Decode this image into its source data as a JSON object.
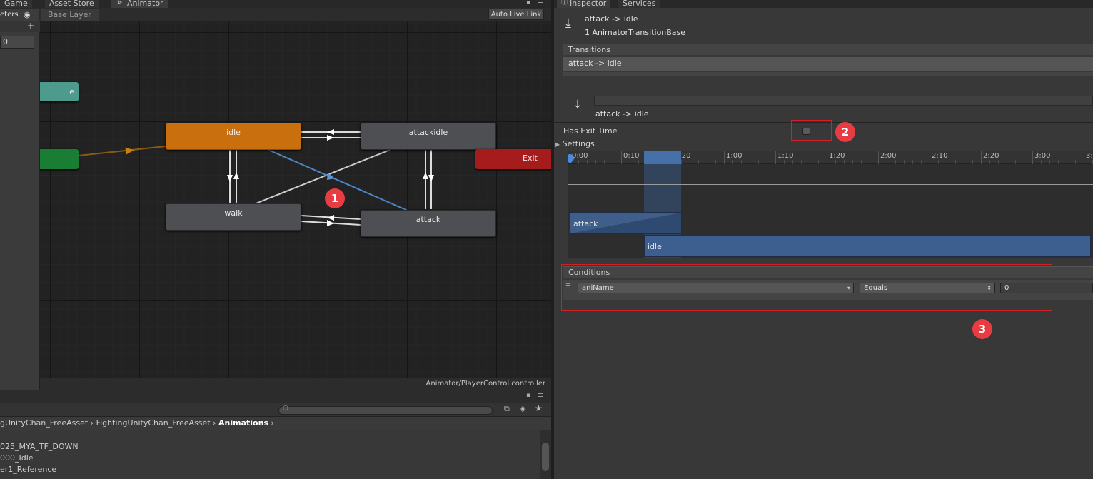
{
  "tabs": {
    "game": "Game",
    "asset_store": "Asset Store",
    "animator": "Animator",
    "inspector": "Inspector",
    "services": "Services"
  },
  "animator": {
    "params_label": "eters",
    "layer": "Base Layer",
    "auto_live_link": "Auto Live Link",
    "param_value": "0",
    "footer_path": "Animator/PlayerControl.controller",
    "states": {
      "idle": "idle",
      "attackidle": "attackidle",
      "walk": "walk",
      "attack": "attack",
      "exit": "Exit",
      "any": "e"
    },
    "badge_1": "1"
  },
  "project": {
    "breadcrumb": [
      "gUnityChan_FreeAsset",
      "FightingUnityChan_FreeAsset",
      "Animations"
    ],
    "files": [
      "025_MYA_TF_DOWN",
      "000_Idle",
      "er1_Reference"
    ]
  },
  "inspector": {
    "title": "attack -> idle",
    "subtitle": "1 AnimatorTransitionBase",
    "transitions_header": "Transitions",
    "transitions_item": "attack -> idle",
    "transition_name": "attack -> idle",
    "has_exit_time_label": "Has Exit Time",
    "has_exit_time": false,
    "settings_label": "Settings",
    "badge_2": "2",
    "badge_3": "3",
    "timeline": {
      "ticks": [
        "0:00",
        "0:10",
        "0:20",
        "1:00",
        "1:10",
        "1:20",
        "2:00",
        "2:10",
        "2:20",
        "3:00",
        "3:"
      ],
      "clip_from": "attack",
      "clip_to": "idle"
    },
    "conditions_header": "Conditions",
    "condition": {
      "parameter": "aniName",
      "mode": "Equals",
      "value": "0"
    }
  },
  "colors": {
    "idle_state": "#c96f0e",
    "exit_state": "#a61b1b",
    "entry_state": "#1a7d34",
    "any_state": "#4d9b8c",
    "selected_transition": "#4d86c6",
    "annotation": "#e83c42"
  }
}
